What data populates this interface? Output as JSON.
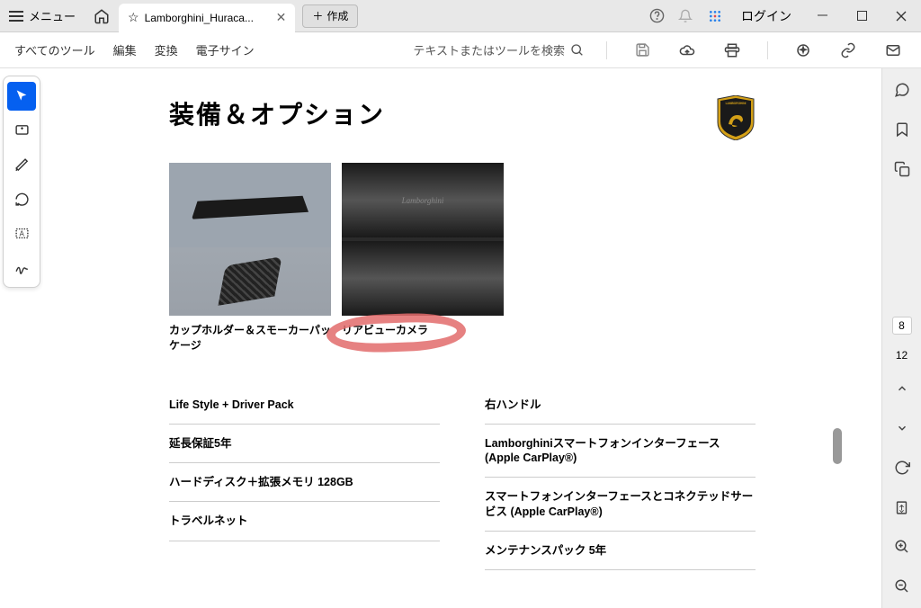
{
  "titlebar": {
    "menu": "メニュー",
    "tab_name": "Lamborghini_Huraca...",
    "create": "作成",
    "login": "ログイン"
  },
  "toolbar": {
    "all_tools": "すべてのツール",
    "edit": "編集",
    "convert": "変換",
    "esign": "電子サイン",
    "search_placeholder": "テキストまたはツールを検索"
  },
  "document": {
    "title": "装備＆オプション",
    "brand_name": "LAMBORGHINI",
    "captions": {
      "cupholder": "カップホルダー＆スモーカーパッケージ",
      "rearview": "リアビューカメラ"
    },
    "rear_script": "Lamborghini",
    "options_left": [
      "Life Style + Driver Pack",
      "延長保証5年",
      "ハードディスク＋拡張メモリ 128GB",
      "トラベルネット"
    ],
    "options_right": [
      "右ハンドル",
      "Lamborghiniスマートフォンインターフェース (Apple CarPlay®)",
      "スマートフォンインターフェースとコネクテッドサービス (Apple CarPlay®)",
      "メンテナンスパック 5年"
    ]
  },
  "pager": {
    "current": "8",
    "total": "12"
  }
}
